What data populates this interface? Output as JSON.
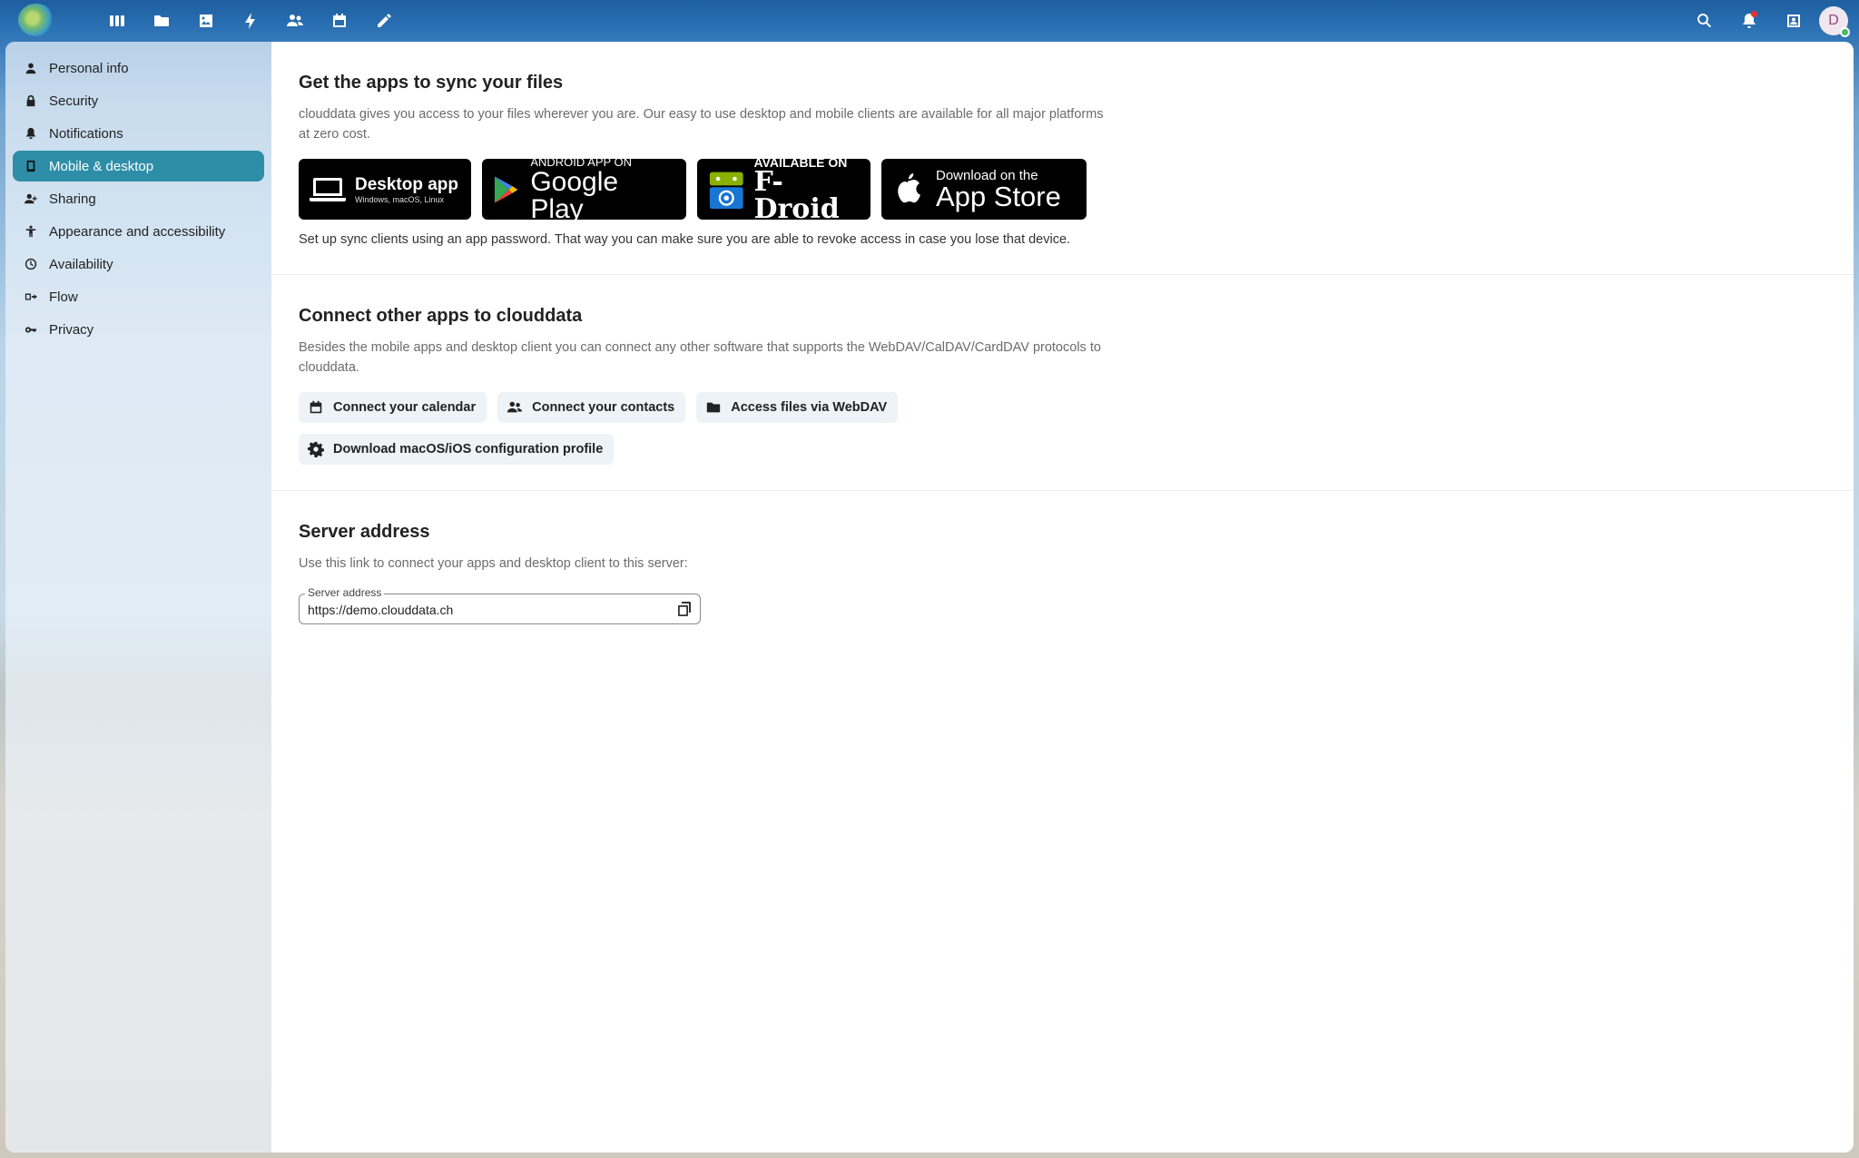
{
  "header": {
    "app_icons": [
      "dashboard-icon",
      "files-icon",
      "photos-icon",
      "activity-icon",
      "contacts-icon",
      "calendar-icon",
      "notes-icon"
    ],
    "right_icons": [
      "search-icon",
      "notifications-icon",
      "contacts-menu-icon"
    ],
    "avatar_initial": "D"
  },
  "sidebar": {
    "items": [
      {
        "label": "Personal info",
        "icon": "person-icon"
      },
      {
        "label": "Security",
        "icon": "lock-icon"
      },
      {
        "label": "Notifications",
        "icon": "bell-icon"
      },
      {
        "label": "Mobile & desktop",
        "icon": "phone-icon",
        "active": true
      },
      {
        "label": "Sharing",
        "icon": "share-icon"
      },
      {
        "label": "Appearance and accessibility",
        "icon": "accessibility-icon"
      },
      {
        "label": "Availability",
        "icon": "clock-icon"
      },
      {
        "label": "Flow",
        "icon": "flow-icon"
      },
      {
        "label": "Privacy",
        "icon": "key-icon"
      }
    ]
  },
  "sync": {
    "title": "Get the apps to sync your files",
    "description": "clouddata gives you access to your files wherever you are. Our easy to use desktop and mobile clients are available for all major platforms at zero cost.",
    "badges": {
      "desktop": {
        "title": "Desktop app",
        "subtitle": "Windows, macOS, Linux"
      },
      "gplay": {
        "top": "ANDROID APP ON",
        "main": "Google Play"
      },
      "fdroid": {
        "top": "AVAILABLE ON",
        "main": "F-Droid"
      },
      "appstore": {
        "top": "Download on the",
        "main": "App Store"
      }
    },
    "note": "Set up sync clients using an app password. That way you can make sure you are able to revoke access in case you lose that device."
  },
  "connect": {
    "title": "Connect other apps to clouddata",
    "description": "Besides the mobile apps and desktop client you can connect any other software that supports the WebDAV/CalDAV/CardDAV protocols to clouddata.",
    "buttons": {
      "calendar": "Connect your calendar",
      "contacts": "Connect your contacts",
      "webdav": "Access files via WebDAV",
      "profile": "Download macOS/iOS configuration profile"
    }
  },
  "server": {
    "title": "Server address",
    "description": "Use this link to connect your apps and desktop client to this server:",
    "field_label": "Server address",
    "field_value": "https://demo.clouddata.ch"
  },
  "colors": {
    "accent": "#2e8ea8",
    "button_bg": "#edf3f7"
  }
}
